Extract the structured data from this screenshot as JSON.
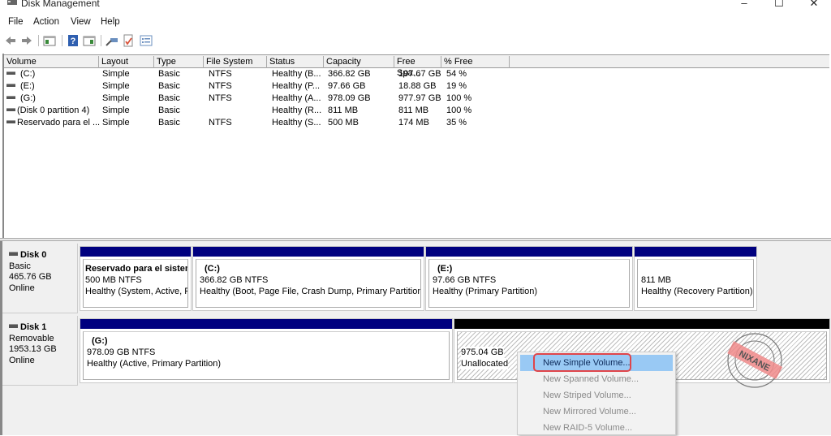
{
  "window": {
    "title": "Disk Management",
    "controls": {
      "minimize": "–",
      "maximize": "☐",
      "close": "✕"
    }
  },
  "menu": [
    "File",
    "Action",
    "View",
    "Help"
  ],
  "toolbar": {
    "icons": [
      "back-arrow-icon",
      "forward-arrow-icon",
      "console-tree-icon",
      "help-icon",
      "show-pane-icon",
      "connect-icon",
      "checklist-icon",
      "properties-icon"
    ]
  },
  "volume_list": {
    "columns": [
      "Volume",
      "Layout",
      "Type",
      "File System",
      "Status",
      "Capacity",
      "Free Spa...",
      "% Free"
    ],
    "rows": [
      [
        "(C:)",
        "Simple",
        "Basic",
        "NTFS",
        "Healthy (B...",
        "366.82 GB",
        "197.67 GB",
        "54 %"
      ],
      [
        "(E:)",
        "Simple",
        "Basic",
        "NTFS",
        "Healthy (P...",
        "97.66 GB",
        "18.88 GB",
        "19 %"
      ],
      [
        "(G:)",
        "Simple",
        "Basic",
        "NTFS",
        "Healthy (A...",
        "978.09 GB",
        "977.97 GB",
        "100 %"
      ],
      [
        "(Disk 0 partition 4)",
        "Simple",
        "Basic",
        "",
        "Healthy (R...",
        "811 MB",
        "811 MB",
        "100 %"
      ],
      [
        "Reservado para el ...",
        "Simple",
        "Basic",
        "NTFS",
        "Healthy (S...",
        "500 MB",
        "174 MB",
        "35 %"
      ]
    ]
  },
  "disks": [
    {
      "name": "Disk 0",
      "type": "Basic",
      "size": "465.76 GB",
      "state": "Online",
      "partitions": [
        {
          "name": "Reservado para el sistem",
          "size": "500 MB NTFS",
          "status": "Healthy (System, Active, P"
        },
        {
          "name": "(C:)",
          "size": "366.82 GB NTFS",
          "status": "Healthy (Boot, Page File, Crash Dump, Primary Partition)"
        },
        {
          "name": "(E:)",
          "size": "97.66 GB NTFS",
          "status": "Healthy (Primary Partition)"
        },
        {
          "name": "",
          "size": "811 MB",
          "status": "Healthy (Recovery Partition)"
        }
      ]
    },
    {
      "name": "Disk 1",
      "type": "Removable",
      "size": "1953.13 GB",
      "state": "Online",
      "partitions": [
        {
          "name": "(G:)",
          "size": "978.09 GB NTFS",
          "status": "Healthy (Active, Primary Partition)"
        },
        {
          "name": "",
          "size": "975.04 GB",
          "status": "Unallocated"
        }
      ]
    }
  ],
  "context_menu": {
    "items": [
      {
        "label": "New Simple Volume...",
        "enabled": true,
        "highlighted": true
      },
      {
        "label": "New Spanned Volume...",
        "enabled": false
      },
      {
        "label": "New Striped Volume...",
        "enabled": false
      },
      {
        "label": "New Mirrored Volume...",
        "enabled": false
      },
      {
        "label": "New RAID-5 Volume...",
        "enabled": false
      }
    ]
  },
  "watermark": {
    "text": "NIXANE"
  },
  "colors": {
    "partition_bar": "#00007f",
    "unallocated_bar": "#000000",
    "menu_highlight": "#99c9f4",
    "highlight_ring": "#e0454a"
  }
}
